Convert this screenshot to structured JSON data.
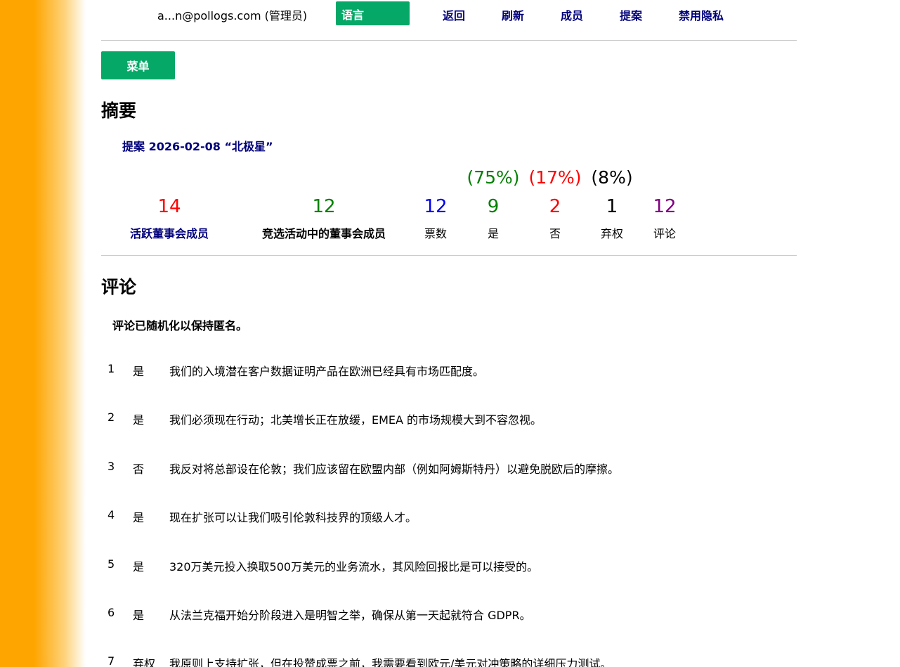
{
  "header": {
    "user": "a...n@pollogs.com (管理员)",
    "language_button": "语言",
    "nav": {
      "back": "返回",
      "refresh": "刷新",
      "members": "成员",
      "proposals": "提案",
      "disable_privacy": "禁用隐私"
    }
  },
  "menu_button": "菜单",
  "summary": {
    "heading": "摘要",
    "proposal_link": "提案 2026-02-08 “北极星”",
    "percentages": {
      "yes": "(75%)",
      "no": "(17%)",
      "abstain": "(8%)"
    },
    "stats": [
      {
        "value": "14",
        "label": "活跃董事会成员",
        "color": "#ff0000",
        "label_color": "#00007a",
        "label_bold": true
      },
      {
        "value": "12",
        "label": "竞选活动中的董事会成员",
        "color": "#008000",
        "label_color": "#000000",
        "label_bold": true
      },
      {
        "value": "12",
        "label": "票数",
        "color": "#0000ee",
        "label_color": "#000000",
        "label_bold": false
      },
      {
        "value": "9",
        "label": "是",
        "color": "#008000",
        "label_color": "#000000",
        "label_bold": false
      },
      {
        "value": "2",
        "label": "否",
        "color": "#ff0000",
        "label_color": "#000000",
        "label_bold": false
      },
      {
        "value": "1",
        "label": "弃权",
        "color": "#000000",
        "label_color": "#000000",
        "label_bold": false
      },
      {
        "value": "12",
        "label": "评论",
        "color": "#800080",
        "label_color": "#000000",
        "label_bold": false
      }
    ]
  },
  "comments": {
    "heading": "评论",
    "anonymity_note": "评论已随机化以保持匿名。",
    "items": [
      {
        "num": "1",
        "vote": "是",
        "text": "我们的入境潜在客户数据证明产品在欧洲已经具有市场匹配度。"
      },
      {
        "num": "2",
        "vote": "是",
        "text": "我们必须现在行动；北美增长正在放缓，EMEA 的市场规模大到不容忽视。"
      },
      {
        "num": "3",
        "vote": "否",
        "text": "我反对将总部设在伦敦；我们应该留在欧盟内部（例如阿姆斯特丹）以避免脱欧后的摩擦。"
      },
      {
        "num": "4",
        "vote": "是",
        "text": "现在扩张可以让我们吸引伦敦科技界的顶级人才。"
      },
      {
        "num": "5",
        "vote": "是",
        "text": "320万美元投入换取500万美元的业务流水，其风险回报比是可以接受的。"
      },
      {
        "num": "6",
        "vote": "是",
        "text": "从法兰克福开始分阶段进入是明智之举，确保从第一天起就符合 GDPR。"
      },
      {
        "num": "7",
        "vote": "弃权",
        "text": "我原则上支持扩张，但在投赞成票之前，我需要看到欧元/美元对冲策略的详细压力测试。"
      }
    ]
  },
  "colors": {
    "accent_green": "#06a867",
    "link_navy": "#00007a",
    "sidebar_orange": "#ffa500"
  }
}
